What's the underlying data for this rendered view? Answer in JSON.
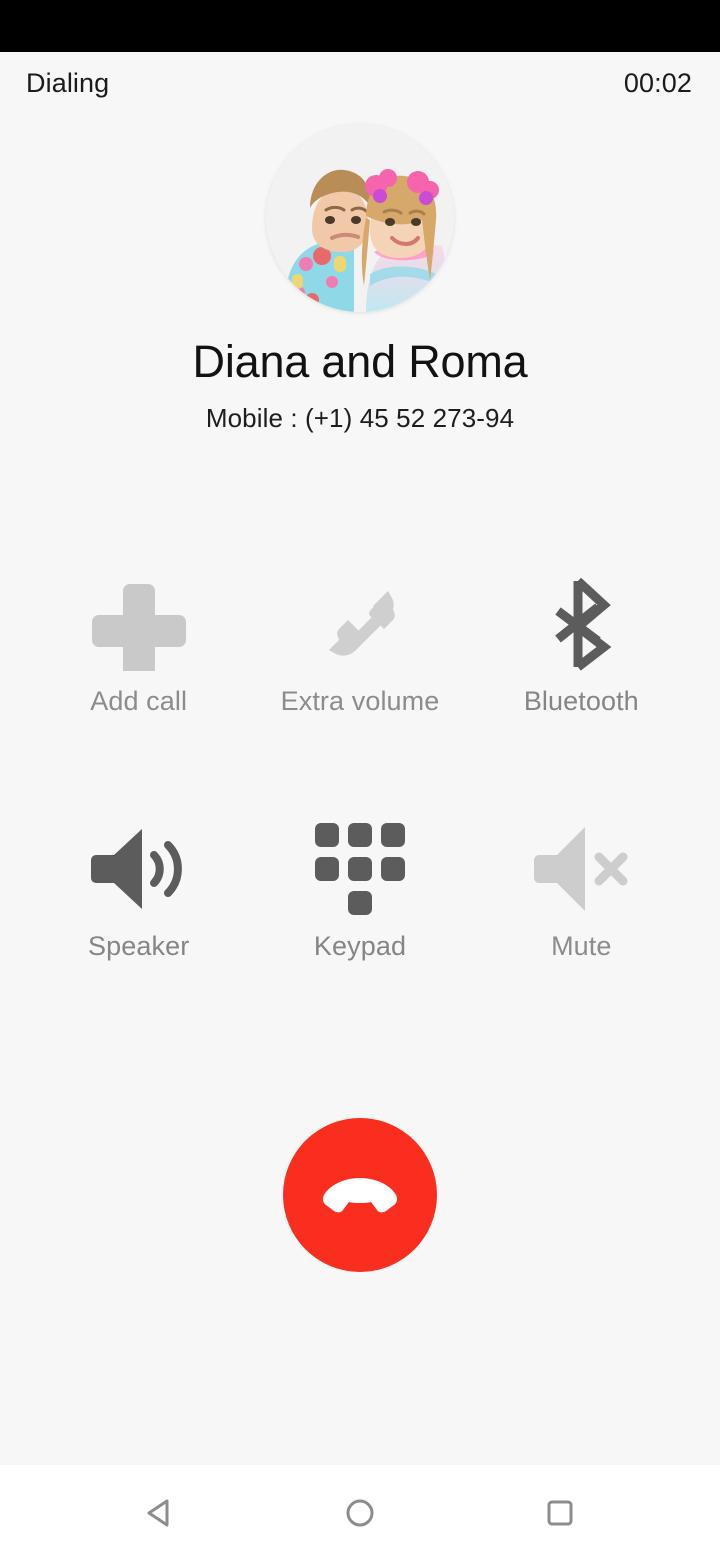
{
  "status_bar": {
    "background": "#000000"
  },
  "call": {
    "state_label": "Dialing",
    "timer": "00:02",
    "contact_name": "Diana and Roma",
    "contact_number": "Mobile : (+1) 45 52 273-94",
    "avatar_icon": "contact-photo-two-children"
  },
  "actions": [
    {
      "label": "Add call",
      "icon": "plus-icon",
      "enabled": false,
      "icon_color": "#c9c9c9"
    },
    {
      "label": "Extra volume",
      "icon": "handset-volume-icon",
      "enabled": false,
      "icon_color": "#cfcfcf"
    },
    {
      "label": "Bluetooth",
      "icon": "bluetooth-icon",
      "enabled": true,
      "icon_color": "#5c5c5c"
    },
    {
      "label": "Speaker",
      "icon": "speaker-on-icon",
      "enabled": true,
      "icon_color": "#5c5c5c"
    },
    {
      "label": "Keypad",
      "icon": "dialpad-icon",
      "enabled": true,
      "icon_color": "#5c5c5c"
    },
    {
      "label": "Mute",
      "icon": "mute-icon",
      "enabled": false,
      "icon_color": "#cdcdcd"
    }
  ],
  "end_call": {
    "icon": "end-call-handset-icon",
    "color": "#fa2e1e"
  },
  "nav_bar": {
    "back": "back-triangle-icon",
    "home": "home-circle-icon",
    "recents": "recents-square-icon",
    "icon_color": "#8d8d8d"
  }
}
